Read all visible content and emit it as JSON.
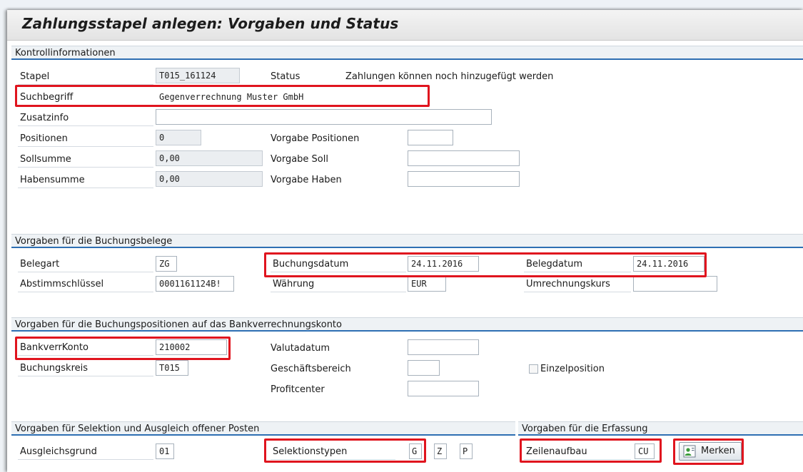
{
  "title": "Zahlungsstapel anlegen: Vorgaben und Status",
  "kontroll": {
    "header": "Kontrollinformationen",
    "stapel_label": "Stapel",
    "stapel_value": "T015_161124",
    "status_label": "Status",
    "status_value": "Zahlungen können noch hinzugefügt werden",
    "suchbegriff_label": "Suchbegriff",
    "suchbegriff_value": "Gegenverrechnung Muster GmbH",
    "zusatzinfo_label": "Zusatzinfo",
    "zusatzinfo_value": "",
    "positionen_label": "Positionen",
    "positionen_value": "0",
    "vorgabe_positionen_label": "Vorgabe Positionen",
    "vorgabe_positionen_value": "",
    "sollsumme_label": "Sollsumme",
    "sollsumme_value": "0,00",
    "vorgabe_soll_label": "Vorgabe Soll",
    "vorgabe_soll_value": "",
    "habensumme_label": "Habensumme",
    "habensumme_value": "0,00",
    "vorgabe_haben_label": "Vorgabe Haben",
    "vorgabe_haben_value": ""
  },
  "belege": {
    "header": "Vorgaben für die Buchungsbelege",
    "belegart_label": "Belegart",
    "belegart_value": "ZG",
    "buchungsdatum_label": "Buchungsdatum",
    "buchungsdatum_value": "24.11.2016",
    "belegdatum_label": "Belegdatum",
    "belegdatum_value": "24.11.2016",
    "abstimm_label": "Abstimmschlüssel",
    "abstimm_value": "0001161124B!",
    "waehrung_label": "Währung",
    "waehrung_value": "EUR",
    "kurs_label": "Umrechnungskurs",
    "kurs_value": ""
  },
  "bankpos": {
    "header": "Vorgaben für die Buchungspositionen auf das Bankverrechnungskonto",
    "konto_label": "BankverrKonto",
    "konto_value": "210002",
    "valuta_label": "Valutadatum",
    "valuta_value": "",
    "bukrs_label": "Buchungskreis",
    "bukrs_value": "T015",
    "gsber_label": "Geschäftsbereich",
    "gsber_value": "",
    "einzel_label": "Einzelposition",
    "profit_label": "Profitcenter",
    "profit_value": ""
  },
  "selektion": {
    "header": "Vorgaben für Selektion und Ausgleich offener Posten",
    "grund_label": "Ausgleichsgrund",
    "grund_value": "01",
    "typen_label": "Selektionstypen",
    "typ1": "G",
    "typ2": "Z",
    "typ3": "P"
  },
  "erfassung": {
    "header": "Vorgaben für die Erfassung",
    "zeile_label": "Zeilenaufbau",
    "zeile_value": "CU",
    "merken_label": "Merken",
    "merken_icon": "screen-variant-icon"
  },
  "colors": {
    "highlight": "#e0141e",
    "section_line": "#2e6fb3"
  }
}
